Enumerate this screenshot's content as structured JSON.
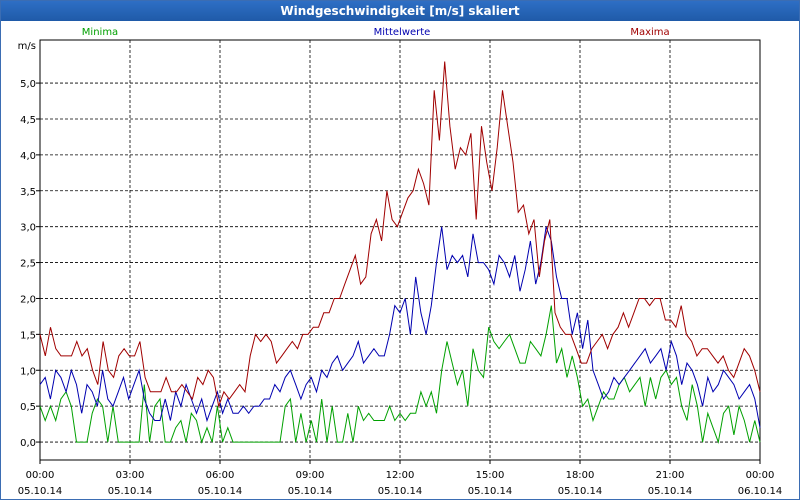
{
  "window": {
    "title": "Windgeschwindigkeit [m/s] skaliert"
  },
  "chart_data": {
    "type": "line",
    "title": "Windgeschwindigkeit [m/s] skaliert",
    "ylabel": "m/s",
    "xlabel": "",
    "ylim": [
      -0.25,
      5.6
    ],
    "xlim": [
      0,
      24
    ],
    "y_ticks": [
      "0,0",
      "0,5",
      "1,0",
      "1,5",
      "2,0",
      "2,5",
      "3,0",
      "3,5",
      "4,0",
      "4,5",
      "5,0"
    ],
    "y_tick_values": [
      0,
      0.5,
      1,
      1.5,
      2,
      2.5,
      3,
      3.5,
      4,
      4.5,
      5
    ],
    "x_ticks": [
      {
        "time": "00:00",
        "date": "05.10.14",
        "hour": 0
      },
      {
        "time": "03:00",
        "date": "05.10.14",
        "hour": 3
      },
      {
        "time": "06:00",
        "date": "05.10.14",
        "hour": 6
      },
      {
        "time": "09:00",
        "date": "05.10.14",
        "hour": 9
      },
      {
        "time": "12:00",
        "date": "05.10.14",
        "hour": 12
      },
      {
        "time": "15:00",
        "date": "05.10.14",
        "hour": 15
      },
      {
        "time": "18:00",
        "date": "05.10.14",
        "hour": 18
      },
      {
        "time": "21:00",
        "date": "05.10.14",
        "hour": 21
      },
      {
        "time": "00:00",
        "date": "06.10.14",
        "hour": 24
      }
    ],
    "grid": true,
    "legend_placement": "top",
    "x_hours": [
      0,
      0.2,
      0.4,
      0.6,
      0.8,
      1,
      1.2,
      1.4,
      1.6,
      1.8,
      2,
      2.2,
      2.4,
      2.6,
      2.8,
      3,
      3.2,
      3.4,
      3.6,
      3.8,
      4,
      4.2,
      4.4,
      4.6,
      4.8,
      5,
      5.2,
      5.4,
      5.6,
      5.8,
      6,
      6.2,
      6.4,
      6.6,
      6.8,
      7,
      7.2,
      7.4,
      7.6,
      7.8,
      8,
      8.2,
      8.4,
      8.6,
      8.8,
      9,
      9.2,
      9.4,
      9.6,
      9.8,
      10,
      10.2,
      10.4,
      10.6,
      10.8,
      11,
      11.2,
      11.4,
      11.6,
      11.8,
      12,
      12.2,
      12.4,
      12.6,
      12.8,
      13,
      13.2,
      13.4,
      13.6,
      13.8,
      14,
      14.2,
      14.4,
      14.6,
      14.8,
      15,
      15.2,
      15.4,
      15.6,
      15.8,
      16,
      16.2,
      16.4,
      16.6,
      16.8,
      17,
      17.2,
      17.4,
      17.6,
      17.8,
      18,
      18.2,
      18.4,
      18.6,
      18.8,
      19,
      19.2,
      19.4,
      19.6,
      19.8,
      20,
      20.2,
      20.4,
      20.6,
      20.8,
      21,
      21.2,
      21.4,
      21.6,
      21.8,
      22,
      22.2,
      22.4,
      22.6,
      22.8,
      23,
      23.2,
      23.4,
      23.6,
      23.8,
      24
    ],
    "series": [
      {
        "name": "Minima",
        "color": "#00a000",
        "values": [
          0.5,
          0.3,
          0.5,
          0.3,
          0.6,
          0.7,
          0.5,
          0.0,
          0.0,
          0.0,
          0.4,
          0.6,
          0.5,
          0.0,
          0.5,
          0.0,
          0.0,
          0.0,
          0.0,
          0.0,
          0.8,
          0.0,
          0.5,
          0.6,
          0.0,
          0.0,
          0.2,
          0.3,
          0.0,
          0.4,
          0.3,
          0.0,
          0.2,
          0.0,
          0.5,
          0.0,
          0.2,
          0.0,
          0.0,
          0.0,
          0.0,
          0.0,
          0.0,
          0.0,
          0.0,
          0.0,
          0.0,
          0.5,
          0.6,
          0.0,
          0.4,
          0.0,
          0.3,
          0.0,
          0.6,
          0.0,
          0.5,
          0.0,
          0.0,
          0.4,
          0.0,
          0.5,
          0.3,
          0.4,
          0.3,
          0.3,
          0.3,
          0.5,
          0.3,
          0.4,
          0.3,
          0.4,
          0.4,
          0.7,
          0.5,
          0.7,
          0.4,
          1.0,
          1.4,
          1.1,
          0.8,
          1.0,
          0.5,
          1.3,
          1.0,
          0.9,
          1.6,
          1.4,
          1.3,
          1.4,
          1.5,
          1.3,
          1.1,
          1.1,
          1.4,
          1.3,
          1.2,
          1.5,
          1.9,
          1.1,
          1.3,
          0.9,
          1.2,
          0.9,
          0.5,
          0.6,
          0.3,
          0.5,
          0.7,
          0.6,
          0.6,
          0.8,
          0.9,
          0.7,
          0.8,
          0.9,
          0.5,
          0.9,
          0.6,
          0.9,
          1.0,
          0.8,
          0.9,
          0.5,
          0.3,
          0.8,
          0.5,
          0.0,
          0.4,
          0.2,
          0.0,
          0.4,
          0.5,
          0.1,
          0.5,
          0.3,
          0.0,
          0.3,
          0.0
        ],
        "values_note": ""
      },
      {
        "name": "Mittelwerte",
        "color": "#0000b0",
        "values": [
          0.8,
          0.9,
          0.6,
          1.0,
          0.9,
          0.7,
          1.0,
          0.8,
          0.4,
          0.8,
          0.7,
          0.5,
          1.0,
          0.6,
          0.5,
          0.7,
          0.9,
          0.6,
          0.8,
          1.0,
          0.6,
          0.4,
          0.3,
          0.3,
          0.6,
          0.3,
          0.7,
          0.5,
          0.8,
          0.6,
          0.4,
          0.6,
          0.3,
          0.5,
          0.7,
          0.4,
          0.6,
          0.4,
          0.4,
          0.5,
          0.4,
          0.5,
          0.5,
          0.6,
          0.6,
          0.8,
          0.7,
          0.9,
          1.0,
          0.8,
          0.6,
          0.8,
          0.9,
          0.7,
          1.0,
          0.9,
          1.1,
          1.2,
          1.0,
          1.1,
          1.2,
          1.4,
          1.1,
          1.2,
          1.3,
          1.2,
          1.2,
          1.5,
          1.9,
          1.8,
          2.0,
          1.5,
          2.3,
          1.8,
          1.5,
          1.9,
          2.5,
          3.0,
          2.4,
          2.6,
          2.5,
          2.6,
          2.3,
          2.9,
          2.5,
          2.5,
          2.4,
          2.2,
          2.6,
          2.5,
          2.3,
          2.6,
          2.1,
          2.4,
          2.8,
          2.2,
          2.5,
          3.0,
          2.8,
          2.3,
          2.0,
          2.0,
          1.5,
          1.8,
          1.3,
          1.7,
          1.0,
          0.8,
          0.6,
          0.7,
          0.9,
          0.8,
          0.9,
          1.0,
          1.1,
          1.2,
          1.3,
          1.1,
          1.2,
          1.3,
          1.0,
          1.4,
          1.2,
          0.8,
          1.1,
          1.0,
          0.8,
          0.5,
          0.9,
          0.7,
          0.8,
          1.0,
          0.9,
          0.8,
          0.6,
          0.7,
          0.8,
          0.6,
          0.2
        ],
        "values_note": ""
      },
      {
        "name": "Maxima",
        "color": "#a00000",
        "values": [
          1.5,
          1.2,
          1.6,
          1.3,
          1.2,
          1.2,
          1.2,
          1.4,
          1.2,
          1.3,
          1.0,
          0.8,
          1.4,
          1.0,
          0.9,
          1.2,
          1.3,
          1.2,
          1.2,
          1.4,
          0.9,
          0.7,
          0.7,
          0.7,
          0.9,
          0.7,
          0.7,
          0.8,
          0.7,
          0.6,
          0.9,
          0.8,
          1.0,
          0.9,
          0.5,
          0.7,
          0.6,
          0.7,
          0.8,
          0.7,
          1.2,
          1.5,
          1.4,
          1.5,
          1.4,
          1.1,
          1.2,
          1.3,
          1.4,
          1.3,
          1.5,
          1.5,
          1.6,
          1.6,
          1.8,
          1.8,
          2.0,
          2.0,
          2.2,
          2.4,
          2.6,
          2.2,
          2.3,
          2.9,
          3.1,
          2.8,
          3.5,
          3.1,
          3.0,
          3.2,
          3.4,
          3.5,
          3.8,
          3.6,
          3.3,
          4.9,
          4.2,
          5.3,
          4.4,
          3.8,
          4.1,
          4.0,
          4.3,
          3.1,
          4.4,
          3.9,
          3.5,
          4.1,
          4.9,
          4.4,
          3.9,
          3.2,
          3.3,
          2.9,
          3.1,
          2.3,
          2.8,
          3.1,
          1.8,
          1.6,
          1.5,
          1.5,
          1.3,
          1.1,
          1.1,
          1.3,
          1.4,
          1.5,
          1.3,
          1.5,
          1.6,
          1.8,
          1.6,
          1.8,
          2.0,
          2.0,
          1.9,
          2.0,
          2.0,
          1.7,
          1.7,
          1.6,
          1.9,
          1.5,
          1.4,
          1.2,
          1.3,
          1.3,
          1.2,
          1.1,
          1.2,
          1.0,
          0.9,
          1.1,
          1.3,
          1.2,
          1.0,
          0.7
        ],
        "values_note": ""
      }
    ]
  }
}
